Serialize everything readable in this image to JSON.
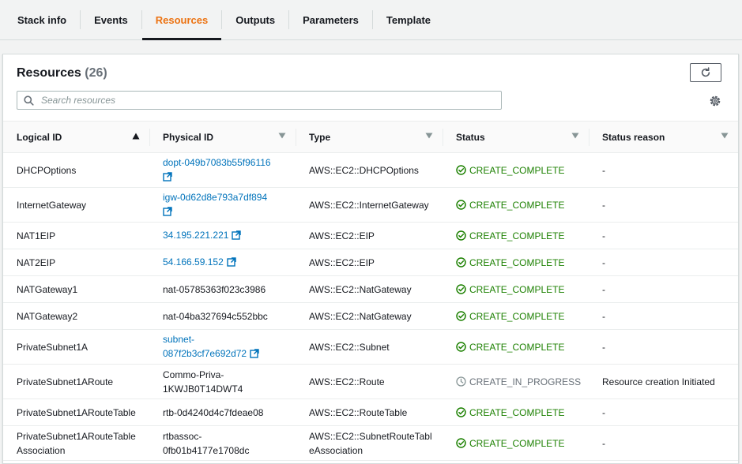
{
  "tabs": [
    {
      "label": "Stack info",
      "active": false
    },
    {
      "label": "Events",
      "active": false
    },
    {
      "label": "Resources",
      "active": true
    },
    {
      "label": "Outputs",
      "active": false
    },
    {
      "label": "Parameters",
      "active": false
    },
    {
      "label": "Template",
      "active": false
    }
  ],
  "panel": {
    "title": "Resources",
    "count": "(26)",
    "search_placeholder": "Search resources"
  },
  "columns": [
    "Logical ID",
    "Physical ID",
    "Type",
    "Status",
    "Status reason"
  ],
  "colors": {
    "accent": "#ec7211",
    "link": "#0073bb",
    "success": "#1d8102",
    "pending": "#687078"
  },
  "rows": [
    {
      "logical_id": "DHCPOptions",
      "physical_id": [
        "dopt-049b7083b55f96116"
      ],
      "physical_link": true,
      "ext_icon": true,
      "type": [
        "AWS::EC2::DHCPOptions"
      ],
      "status": "CREATE_COMPLETE",
      "status_kind": "complete",
      "reason": "-"
    },
    {
      "logical_id": "InternetGateway",
      "physical_id": [
        "igw-0d62d8e793a7df894"
      ],
      "physical_link": true,
      "ext_icon": true,
      "type": [
        "AWS::EC2::InternetGateway"
      ],
      "status": "CREATE_COMPLETE",
      "status_kind": "complete",
      "reason": "-"
    },
    {
      "logical_id": "NAT1EIP",
      "physical_id": [
        "34.195.221.221"
      ],
      "physical_link": true,
      "ext_icon": true,
      "type": [
        "AWS::EC2::EIP"
      ],
      "status": "CREATE_COMPLETE",
      "status_kind": "complete",
      "reason": "-"
    },
    {
      "logical_id": "NAT2EIP",
      "physical_id": [
        "54.166.59.152"
      ],
      "physical_link": true,
      "ext_icon": true,
      "type": [
        "AWS::EC2::EIP"
      ],
      "status": "CREATE_COMPLETE",
      "status_kind": "complete",
      "reason": "-"
    },
    {
      "logical_id": "NATGateway1",
      "physical_id": [
        "nat-05785363f023c3986"
      ],
      "physical_link": false,
      "ext_icon": false,
      "type": [
        "AWS::EC2::NatGateway"
      ],
      "status": "CREATE_COMPLETE",
      "status_kind": "complete",
      "reason": "-"
    },
    {
      "logical_id": "NATGateway2",
      "physical_id": [
        "nat-04ba327694c552bbc"
      ],
      "physical_link": false,
      "ext_icon": false,
      "type": [
        "AWS::EC2::NatGateway"
      ],
      "status": "CREATE_COMPLETE",
      "status_kind": "complete",
      "reason": "-"
    },
    {
      "logical_id": "PrivateSubnet1A",
      "physical_id": [
        "subnet-",
        "087f2b3cf7e692d72"
      ],
      "physical_link": true,
      "ext_icon": true,
      "type": [
        "AWS::EC2::Subnet"
      ],
      "status": "CREATE_COMPLETE",
      "status_kind": "complete",
      "reason": "-"
    },
    {
      "logical_id": "PrivateSubnet1ARoute",
      "physical_id": [
        "Commo-Priva-",
        "1KWJB0T14DWT4"
      ],
      "physical_link": false,
      "ext_icon": false,
      "type": [
        "AWS::EC2::Route"
      ],
      "status": "CREATE_IN_PROGRESS",
      "status_kind": "progress",
      "reason": "Resource creation Initiated"
    },
    {
      "logical_id": "PrivateSubnet1ARouteTable",
      "physical_id": [
        "rtb-0d4240d4c7fdeae08"
      ],
      "physical_link": false,
      "ext_icon": false,
      "type": [
        "AWS::EC2::RouteTable"
      ],
      "status": "CREATE_COMPLETE",
      "status_kind": "complete",
      "reason": "-"
    },
    {
      "logical_id": "PrivateSubnet1ARouteTable Association",
      "physical_id": [
        "rtbassoc-",
        "0fb01b4177e1708dc"
      ],
      "physical_link": false,
      "ext_icon": false,
      "type": [
        "AWS::EC2::SubnetRouteTabl",
        "eAssociation"
      ],
      "status": "CREATE_COMPLETE",
      "status_kind": "complete",
      "reason": "-"
    }
  ]
}
